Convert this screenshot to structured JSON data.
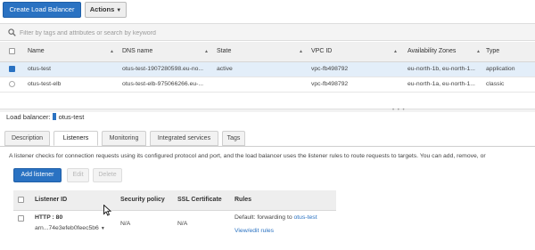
{
  "toolbar": {
    "create_label": "Create Load Balancer",
    "actions_label": "Actions"
  },
  "filter": {
    "placeholder": "Filter by tags and attributes or search by keyword"
  },
  "lb_table": {
    "columns": [
      "Name",
      "DNS name",
      "State",
      "VPC ID",
      "Availability Zones",
      "Type"
    ],
    "rows": [
      {
        "name": "otus-test",
        "dns": "otus-test-1907280598.eu-no...",
        "state": "active",
        "vpc": "vpc-fb498792",
        "zones": "eu-north-1b, eu-north-1...",
        "type": "application"
      },
      {
        "name": "otus-test-elb",
        "dns": "otus-test-elb-975066266.eu-...",
        "state": "",
        "vpc": "vpc-fb498792",
        "zones": "eu-north-1a, eu-north-1...",
        "type": "classic"
      }
    ]
  },
  "detail": {
    "label_prefix": "Load balancer:",
    "selected_name": "otus-test",
    "tabs": [
      "Description",
      "Listeners",
      "Monitoring",
      "Integrated services",
      "Tags"
    ],
    "description": "A listener checks for connection requests using its configured protocol and port, and the load balancer uses the listener rules to route requests to targets. You can add, remove, or",
    "buttons": {
      "add": "Add listener",
      "edit": "Edit",
      "delete": "Delete"
    },
    "listener_table": {
      "columns": [
        "Listener ID",
        "Security policy",
        "SSL Certificate",
        "Rules"
      ],
      "row": {
        "listener_id": "HTTP : 80",
        "arn": "arn...74e3efeb0feec5b6",
        "security_policy": "N/A",
        "ssl_certificate": "N/A",
        "rules_prefix": "Default:",
        "rules_text": "forwarding to",
        "rules_target": "otus-test",
        "view_edit": "View/edit rules"
      }
    }
  },
  "colors": {
    "primary": "#2a72c2",
    "selected_row": "#e3eef9"
  }
}
